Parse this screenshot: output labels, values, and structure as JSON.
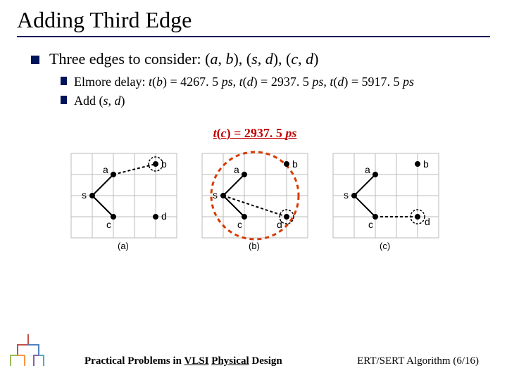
{
  "title": "Adding Third Edge",
  "main_bullet": "Three edges to consider: (a, b), (s, d), (c, d)",
  "sub_bullets": [
    "Elmore delay: t(b) = 4267. 5 ps, t(d) = 2937. 5 ps, t(d) = 5917. 5 ps",
    "Add (s, d)"
  ],
  "highlight": "t(c) = 2937. 5 ps",
  "diagrams": {
    "labels": [
      "a",
      "b",
      "c",
      "d",
      "s"
    ],
    "captions": [
      "(a)",
      "(b)",
      "(c)"
    ],
    "circled_index": 1
  },
  "footer": {
    "left_prefix": "Practical Problems in ",
    "left_u1": "VLSI",
    "left_mid": " ",
    "left_u2": "Physical",
    "left_suffix": " Design",
    "right": "ERT/SERT Algorithm (6/16)"
  }
}
